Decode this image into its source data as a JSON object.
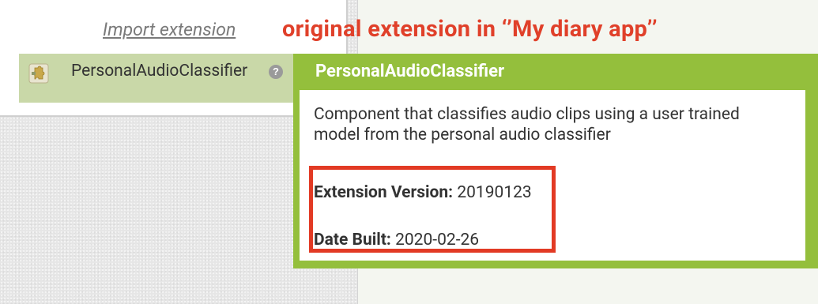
{
  "sidebar": {
    "import_link": "Import extension",
    "extension_item": {
      "label": "PersonalAudioClassifier",
      "icon": "puzzle-piece-icon",
      "help_icon_glyph": "?"
    }
  },
  "annotation": {
    "text": "original extension in ‘’My diary app’’",
    "color": "#e0402a"
  },
  "popup": {
    "title": "PersonalAudioClassifier",
    "description": "Component that classifies audio clips using a user trained model from the personal audio classifier",
    "version_label": "Extension Version:",
    "version_value": "20190123",
    "date_label": "Date Built:",
    "date_value": "2020-02-26",
    "accent_color": "#94bf3c",
    "highlight_color": "#e23a24"
  }
}
